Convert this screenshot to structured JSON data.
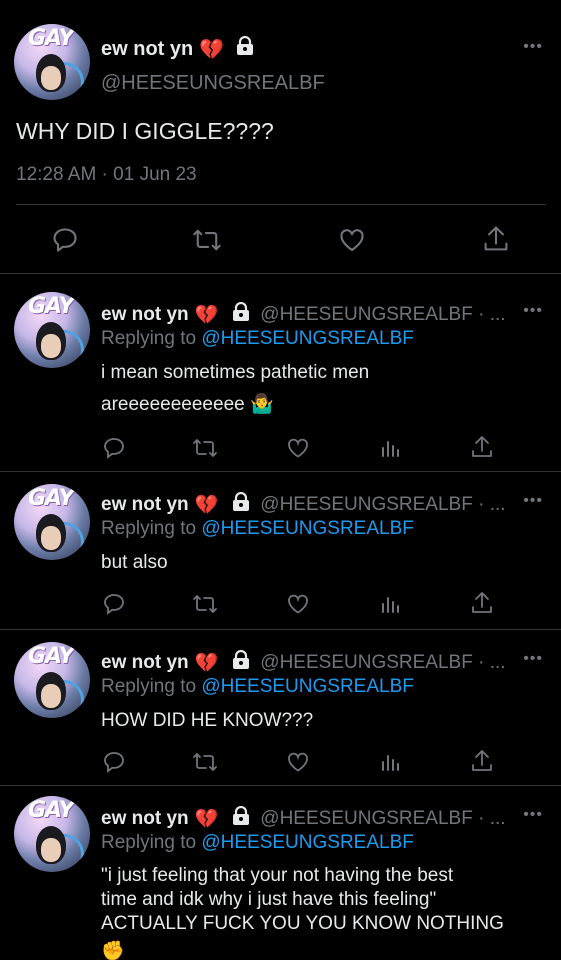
{
  "main_tweet": {
    "display_name": "ew not yn",
    "name_emoji": "💔",
    "handle": "@HEESEUNGSREALBF",
    "text": "WHY DID I GIGGLE????",
    "timestamp": "12:28 AM · 01 Jun 23",
    "avatar_text": "GAY"
  },
  "replies": [
    {
      "display_name": "ew not yn",
      "name_emoji": "💔",
      "handle": "@HEESEUNGSREALBF · ...",
      "replying_prefix": "Replying to",
      "replying_to": "@HEESEUNGSREALBF",
      "text_lines": [
        "i mean sometimes pathetic men",
        "areeeeeeeeeeee 🤷‍♂️"
      ]
    },
    {
      "display_name": "ew not yn",
      "name_emoji": "💔",
      "handle": "@HEESEUNGSREALBF · ...",
      "replying_prefix": "Replying to",
      "replying_to": "@HEESEUNGSREALBF",
      "text_lines": [
        "but also"
      ]
    },
    {
      "display_name": "ew not yn",
      "name_emoji": "💔",
      "handle": "@HEESEUNGSREALBF · ...",
      "replying_prefix": "Replying to",
      "replying_to": "@HEESEUNGSREALBF",
      "text_lines": [
        "HOW DID HE KNOW???"
      ]
    },
    {
      "display_name": "ew not yn",
      "name_emoji": "💔",
      "handle": "@HEESEUNGSREALBF · ...",
      "replying_prefix": "Replying to",
      "replying_to": "@HEESEUNGSREALBF",
      "text_lines": [
        "\"i just feeling that your not having the best",
        "time and idk why i just have this feeling\"",
        "ACTUALLY FUCK YOU YOU KNOW NOTHING",
        "✊"
      ]
    }
  ],
  "more_label": "•••",
  "icons": [
    "reply-icon",
    "retweet-icon",
    "like-icon",
    "views-icon",
    "share-icon",
    "lock-icon"
  ],
  "colors": {
    "background": "#000000",
    "text": "#e7e9ea",
    "muted": "#71767b",
    "link": "#1d9bf0",
    "divider": "#2f3336"
  }
}
